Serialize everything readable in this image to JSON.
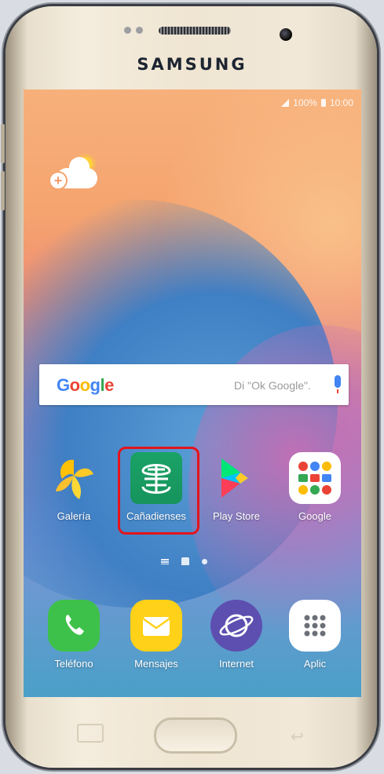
{
  "device": {
    "brand": "SAMSUNG"
  },
  "status_bar": {
    "battery": "100%",
    "time": "10:00"
  },
  "search_widget": {
    "hint": "Di \"Ok Google\"."
  },
  "apps_row": [
    {
      "label": "Galería"
    },
    {
      "label": "Cañadienses"
    },
    {
      "label": "Play Store"
    },
    {
      "label": "Google"
    }
  ],
  "dock": [
    {
      "label": "Teléfono"
    },
    {
      "label": "Mensajes"
    },
    {
      "label": "Internet"
    },
    {
      "label": "Aplic"
    }
  ],
  "colors": {
    "highlight": "#e4141b",
    "canadienses_green": "#1aa267"
  }
}
